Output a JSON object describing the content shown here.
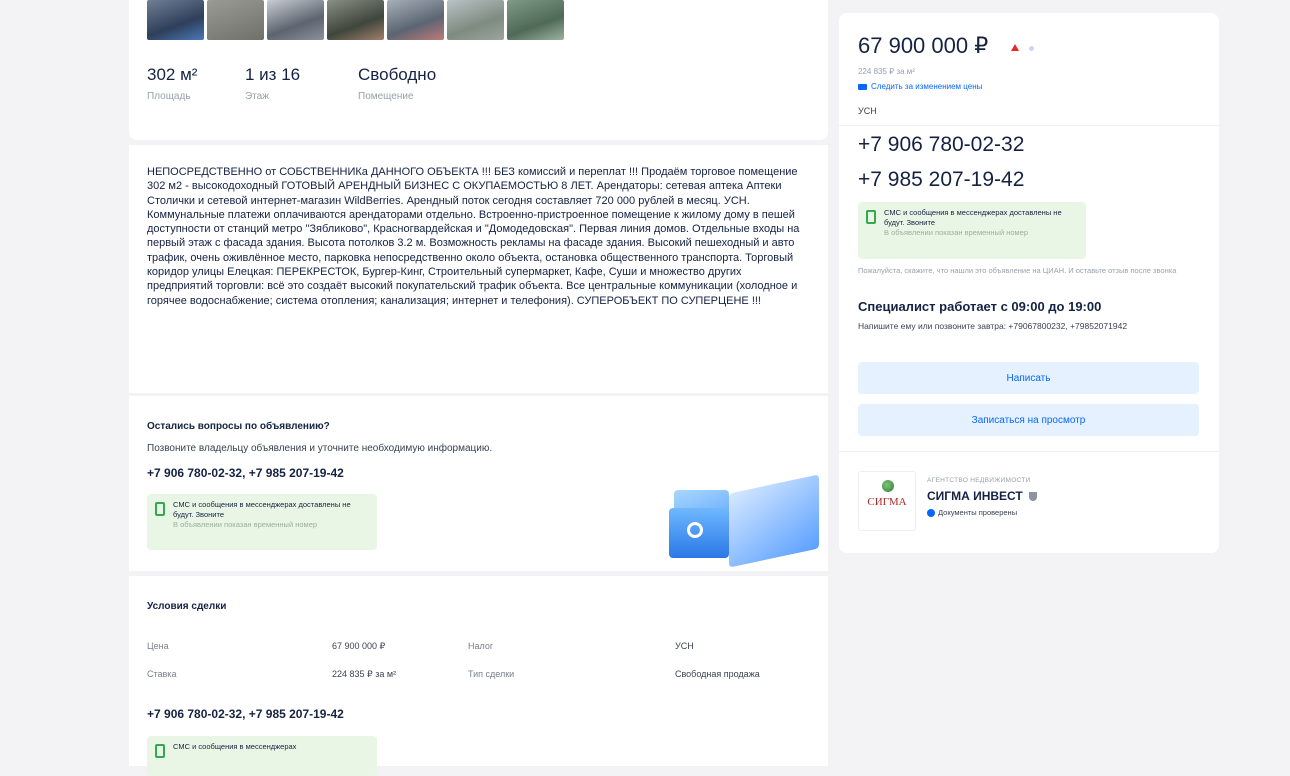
{
  "facts": [
    {
      "value": "302 м²",
      "label": "Площадь"
    },
    {
      "value": "1 из 16",
      "label": "Этаж"
    },
    {
      "value": "Свободно",
      "label": "Помещение"
    }
  ],
  "description": "НЕПОСРЕДСТВЕННО от СОБСТВЕННИКа ДАННОГО ОБЪЕКТА !!! БЕЗ комиссий и переплат !!! Продаём торговое помещение 302 м2 - высокодоходный ГОТОВЫЙ АРЕНДНЫЙ БИЗНЕС С ОКУПАЕМОСТЬЮ 8 ЛЕТ. Арендаторы: сетевая аптека Аптеки Столички и сетевой интернет-магазин WildBerries. Арендный поток сегодня составляет 720 000 рублей в месяц. УСН. Коммунальные платежи оплачиваются арендаторами отдельно. Встроенно-пристроенное помещение к жилому дому в пешей доступности от станций метро \"Зябликово\", Красногвардейская и \"Домодедовская\". Первая линия домов. Отдельные входы на первый этаж с фасада здания. Высота потолков 3.2 м. Возможность рекламы на фасаде здания. Высокий пешеходный и авто трафик, очень оживлённое место, парковка непосредственно около объекта, остановка общественного транспорта. Торговый коридор улицы Елецкая: ПЕРЕКРЕСТОК, Бургер-Кинг, Строительный супермаркет, Кафе, Суши и множество других предприятий торговли: всё это создаёт высокий покупательский трафик объекта. Все центральные коммуникации (холодное и горячее водоснабжение; система отопления; канализация; интернет и телефония). СУПЕРОБЪЕКТ ПО СУПЕРЦЕНЕ !!!",
  "questions": {
    "title": "Остались вопросы по объявлению?",
    "subtitle": "Позвоните владельцу объявления и уточните необходимую информацию.",
    "phones": "+7 906 780-02-32, +7 985 207-19-42",
    "sms_title": "СМС и сообщения в мессенджерах доставлены не будут. Звоните",
    "sms_sub": "В объявлении показан временный номер"
  },
  "deal": {
    "title": "Условия сделки",
    "rows": [
      {
        "k1": "Цена",
        "v1": "67 900 000 ₽",
        "k2": "Налог",
        "v2": "УСН"
      },
      {
        "k1": "Ставка",
        "v1": "224 835 ₽ за м²",
        "k2": "Тип сделки",
        "v2": "Свободная продажа"
      }
    ],
    "phones": "+7 906 780-02-32, +7 985 207-19-42",
    "sms_title": "СМС и сообщения в мессенджерах"
  },
  "price": {
    "value": "67 900 000 ₽",
    "per_m2": "224 835 ₽ за м²",
    "follow": "Следить за изменением цены",
    "tax": "УСН",
    "phone1": "+7 906 780-02-32",
    "phone2": "+7 985 207-19-42",
    "sms_title": "СМС и сообщения в мессенджерах доставлены не будут. Звоните",
    "sms_sub": "В объявлении показан временный номер",
    "notice": "Пожалуйста, скажите, что нашли это объявление на ЦИАН. И оставьте отзыв после звонка",
    "hours_title": "Специалист работает с 09:00 до 19:00",
    "hours_sub": "Напишите ему или позвоните завтра: +79067800232, +79852071942",
    "write_btn": "Написать",
    "view_btn": "Записаться на просмотр"
  },
  "agency": {
    "kind": "АГЕНТСТВО НЕДВИЖИМОСТИ",
    "name": "СИГМА ИНВЕСТ",
    "logo_text": "СИГМА",
    "verified": "Документы проверены"
  },
  "colors": {
    "accent": "#0468ff",
    "price_up": "#e8262b",
    "sms_bg": "#e9f6e6"
  }
}
